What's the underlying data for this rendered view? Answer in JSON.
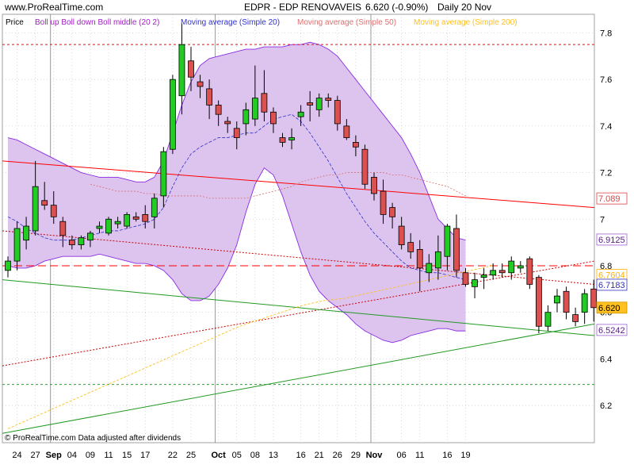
{
  "header": {
    "site": "www.ProRealTime.com",
    "title": "EDPR - EDP RENOVAVEIS",
    "quote": "6.620 (-0.90%)",
    "period": "Daily  20 Nov"
  },
  "footer": {
    "note": "© ProRealTime.com  Data adjusted after dividends"
  },
  "colors": {
    "band_fill": "#dcc4ef",
    "band_line": "#8a2be2",
    "ma20": "#3232c8",
    "ma50": "#dd7070",
    "ma200": "#ffc020",
    "up": "#22cc22",
    "down": "#dd5050",
    "grid": "#c0c0c0",
    "red_trend": "#ff0000",
    "green_trend": "#229922"
  },
  "chart_data": {
    "type": "candlestick",
    "panel_label": "Price",
    "legend": [
      {
        "name": "Boll up Boll down Boll middle (20 2)",
        "color": "#a020c0"
      },
      {
        "name": "Moving average (Simple 20)",
        "color": "#3232c8"
      },
      {
        "name": "Moving average (Simple 50)",
        "color": "#dd7070"
      },
      {
        "name": "Moving average (Simple 200)",
        "color": "#ffc020"
      }
    ],
    "ylim": [
      6.04,
      7.88
    ],
    "y_ticks": [
      6.2,
      6.4,
      6.6,
      6.8,
      7,
      7.2,
      7.4,
      7.6,
      7.8
    ],
    "y_tick_labels": [
      "6.2",
      "6.4",
      "6.6",
      "6.8",
      "7",
      "7.2",
      "7.4",
      "7.6",
      "7.8"
    ],
    "x_ticks": [
      {
        "i": 1,
        "label": "24",
        "bold": false
      },
      {
        "i": 3,
        "label": "27",
        "bold": false
      },
      {
        "i": 5,
        "label": "Sep",
        "bold": true
      },
      {
        "i": 7,
        "label": "04",
        "bold": false
      },
      {
        "i": 9,
        "label": "09",
        "bold": false
      },
      {
        "i": 11,
        "label": "11",
        "bold": false
      },
      {
        "i": 13,
        "label": "15",
        "bold": false
      },
      {
        "i": 15,
        "label": "17",
        "bold": false
      },
      {
        "i": 18,
        "label": "22",
        "bold": false
      },
      {
        "i": 20,
        "label": "25",
        "bold": false
      },
      {
        "i": 23,
        "label": "Oct",
        "bold": true
      },
      {
        "i": 25,
        "label": "05",
        "bold": false
      },
      {
        "i": 27,
        "label": "08",
        "bold": false
      },
      {
        "i": 29,
        "label": "13",
        "bold": false
      },
      {
        "i": 32,
        "label": "16",
        "bold": false
      },
      {
        "i": 34,
        "label": "21",
        "bold": false
      },
      {
        "i": 36,
        "label": "26",
        "bold": false
      },
      {
        "i": 38,
        "label": "29",
        "bold": false
      },
      {
        "i": 40,
        "label": "Nov",
        "bold": true
      },
      {
        "i": 43,
        "label": "06",
        "bold": false
      },
      {
        "i": 45,
        "label": "11",
        "bold": false
      },
      {
        "i": 48,
        "label": "16",
        "bold": false
      },
      {
        "i": 50,
        "label": "19",
        "bold": false
      }
    ],
    "month_separators": [
      5,
      23,
      40
    ],
    "candles": [
      {
        "o": 6.78,
        "h": 6.84,
        "l": 6.75,
        "c": 6.82
      },
      {
        "o": 6.82,
        "h": 6.99,
        "l": 6.78,
        "c": 6.96
      },
      {
        "o": 6.91,
        "h": 7.01,
        "l": 6.87,
        "c": 6.97
      },
      {
        "o": 6.95,
        "h": 7.25,
        "l": 6.93,
        "c": 7.14
      },
      {
        "o": 7.08,
        "h": 7.16,
        "l": 7.04,
        "c": 7.06
      },
      {
        "o": 7.06,
        "h": 7.12,
        "l": 6.98,
        "c": 7.01
      },
      {
        "o": 6.99,
        "h": 7.01,
        "l": 6.88,
        "c": 6.93
      },
      {
        "o": 6.91,
        "h": 6.93,
        "l": 6.87,
        "c": 6.89
      },
      {
        "o": 6.89,
        "h": 6.93,
        "l": 6.87,
        "c": 6.92
      },
      {
        "o": 6.91,
        "h": 6.95,
        "l": 6.88,
        "c": 6.94
      },
      {
        "o": 6.96,
        "h": 6.99,
        "l": 6.94,
        "c": 6.97
      },
      {
        "o": 6.94,
        "h": 7.01,
        "l": 6.93,
        "c": 7.0
      },
      {
        "o": 6.98,
        "h": 7.01,
        "l": 6.96,
        "c": 6.99
      },
      {
        "o": 6.97,
        "h": 7.03,
        "l": 6.96,
        "c": 7.02
      },
      {
        "o": 7.01,
        "h": 7.03,
        "l": 6.99,
        "c": 7.0
      },
      {
        "o": 7.02,
        "h": 7.06,
        "l": 6.96,
        "c": 6.99
      },
      {
        "o": 7.01,
        "h": 7.11,
        "l": 6.96,
        "c": 7.09
      },
      {
        "o": 7.1,
        "h": 7.31,
        "l": 7.05,
        "c": 7.29
      },
      {
        "o": 7.3,
        "h": 7.62,
        "l": 7.28,
        "c": 7.6
      },
      {
        "o": 7.53,
        "h": 7.84,
        "l": 7.45,
        "c": 7.75
      },
      {
        "o": 7.68,
        "h": 7.74,
        "l": 7.55,
        "c": 7.61
      },
      {
        "o": 7.59,
        "h": 7.62,
        "l": 7.52,
        "c": 7.57
      },
      {
        "o": 7.56,
        "h": 7.6,
        "l": 7.43,
        "c": 7.49
      },
      {
        "o": 7.49,
        "h": 7.51,
        "l": 7.4,
        "c": 7.45
      },
      {
        "o": 7.42,
        "h": 7.44,
        "l": 7.37,
        "c": 7.41
      },
      {
        "o": 7.39,
        "h": 7.42,
        "l": 7.3,
        "c": 7.35
      },
      {
        "o": 7.41,
        "h": 7.5,
        "l": 7.36,
        "c": 7.47
      },
      {
        "o": 7.43,
        "h": 7.66,
        "l": 7.4,
        "c": 7.52
      },
      {
        "o": 7.54,
        "h": 7.64,
        "l": 7.42,
        "c": 7.46
      },
      {
        "o": 7.46,
        "h": 7.48,
        "l": 7.37,
        "c": 7.41
      },
      {
        "o": 7.35,
        "h": 7.37,
        "l": 7.31,
        "c": 7.33
      },
      {
        "o": 7.34,
        "h": 7.39,
        "l": 7.3,
        "c": 7.35
      },
      {
        "o": 7.44,
        "h": 7.49,
        "l": 7.4,
        "c": 7.46
      },
      {
        "o": 7.5,
        "h": 7.55,
        "l": 7.42,
        "c": 7.49
      },
      {
        "o": 7.47,
        "h": 7.54,
        "l": 7.44,
        "c": 7.52
      },
      {
        "o": 7.52,
        "h": 7.54,
        "l": 7.48,
        "c": 7.51
      },
      {
        "o": 7.51,
        "h": 7.53,
        "l": 7.38,
        "c": 7.41
      },
      {
        "o": 7.4,
        "h": 7.43,
        "l": 7.34,
        "c": 7.35
      },
      {
        "o": 7.33,
        "h": 7.36,
        "l": 7.27,
        "c": 7.31
      },
      {
        "o": 7.3,
        "h": 7.32,
        "l": 7.13,
        "c": 7.15
      },
      {
        "o": 7.18,
        "h": 7.2,
        "l": 7.08,
        "c": 7.11
      },
      {
        "o": 7.12,
        "h": 7.17,
        "l": 6.98,
        "c": 7.02
      },
      {
        "o": 7.05,
        "h": 7.07,
        "l": 6.96,
        "c": 7.01
      },
      {
        "o": 6.97,
        "h": 7.01,
        "l": 6.87,
        "c": 6.89
      },
      {
        "o": 6.9,
        "h": 6.94,
        "l": 6.83,
        "c": 6.86
      },
      {
        "o": 6.87,
        "h": 6.91,
        "l": 6.69,
        "c": 6.79
      },
      {
        "o": 6.77,
        "h": 6.85,
        "l": 6.73,
        "c": 6.81
      },
      {
        "o": 6.79,
        "h": 6.93,
        "l": 6.74,
        "c": 6.86
      },
      {
        "o": 6.84,
        "h": 6.98,
        "l": 6.78,
        "c": 6.97
      },
      {
        "o": 6.96,
        "h": 7.02,
        "l": 6.75,
        "c": 6.78
      },
      {
        "o": 6.77,
        "h": 6.79,
        "l": 6.71,
        "c": 6.72
      },
      {
        "o": 6.71,
        "h": 6.77,
        "l": 6.66,
        "c": 6.74
      },
      {
        "o": 6.75,
        "h": 6.79,
        "l": 6.7,
        "c": 6.76
      },
      {
        "o": 6.76,
        "h": 6.81,
        "l": 6.74,
        "c": 6.78
      },
      {
        "o": 6.78,
        "h": 6.81,
        "l": 6.75,
        "c": 6.77
      },
      {
        "o": 6.77,
        "h": 6.84,
        "l": 6.74,
        "c": 6.82
      },
      {
        "o": 6.79,
        "h": 6.82,
        "l": 6.77,
        "c": 6.8
      },
      {
        "o": 6.83,
        "h": 6.84,
        "l": 6.7,
        "c": 6.72
      },
      {
        "o": 6.75,
        "h": 6.76,
        "l": 6.51,
        "c": 6.54
      },
      {
        "o": 6.54,
        "h": 6.63,
        "l": 6.52,
        "c": 6.6
      },
      {
        "o": 6.64,
        "h": 6.7,
        "l": 6.6,
        "c": 6.67
      },
      {
        "o": 6.69,
        "h": 6.71,
        "l": 6.57,
        "c": 6.6
      },
      {
        "o": 6.59,
        "h": 6.62,
        "l": 6.54,
        "c": 6.56
      },
      {
        "o": 6.6,
        "h": 6.7,
        "l": 6.55,
        "c": 6.68
      },
      {
        "o": 6.7,
        "h": 6.74,
        "l": 6.56,
        "c": 6.62
      }
    ],
    "boll_up": [
      7.35,
      7.34,
      7.32,
      7.3,
      7.28,
      7.26,
      7.24,
      7.22,
      7.2,
      7.19,
      7.18,
      7.18,
      7.18,
      7.17,
      7.16,
      7.16,
      7.18,
      7.25,
      7.37,
      7.49,
      7.59,
      7.66,
      7.69,
      7.7,
      7.71,
      7.72,
      7.73,
      7.73,
      7.74,
      7.74,
      7.74,
      7.75,
      7.75,
      7.76,
      7.75,
      7.73,
      7.7,
      7.65,
      7.6,
      7.55,
      7.5,
      7.45,
      7.4,
      7.35,
      7.28,
      7.2,
      7.1,
      7.0,
      6.96,
      6.92,
      6.91
    ],
    "boll_low": [
      6.8,
      6.79,
      6.79,
      6.8,
      6.82,
      6.83,
      6.84,
      6.84,
      6.84,
      6.84,
      6.85,
      6.84,
      6.83,
      6.82,
      6.81,
      6.81,
      6.8,
      6.78,
      6.74,
      6.68,
      6.65,
      6.65,
      6.67,
      6.72,
      6.79,
      6.89,
      7.03,
      7.15,
      7.22,
      7.19,
      7.1,
      6.98,
      6.86,
      6.76,
      6.69,
      6.65,
      6.62,
      6.59,
      6.55,
      6.52,
      6.5,
      6.48,
      6.47,
      6.48,
      6.5,
      6.51,
      6.52,
      6.53,
      6.53,
      6.52,
      6.52
    ],
    "ma20": [
      7.01,
      6.99,
      6.96,
      6.94,
      6.92,
      6.91,
      6.91,
      6.91,
      6.92,
      6.93,
      6.94,
      6.95,
      6.95,
      6.96,
      6.97,
      6.98,
      7.0,
      7.05,
      7.14,
      7.22,
      7.28,
      7.31,
      7.33,
      7.35,
      7.35,
      7.36,
      7.37,
      7.37,
      7.4,
      7.43,
      7.44,
      7.45,
      7.42,
      7.37,
      7.31,
      7.25,
      7.18,
      7.11,
      7.05,
      6.99,
      6.94,
      6.9,
      6.86,
      6.82,
      6.79,
      6.78,
      6.77,
      6.77,
      6.76,
      6.75,
      6.74
    ],
    "ma50": [
      7.15,
      7.14,
      7.13,
      7.12,
      7.12,
      7.12,
      7.11,
      7.11,
      7.1,
      7.1,
      7.1,
      7.1,
      7.1,
      7.09,
      7.09,
      7.09,
      7.09,
      7.09,
      7.1,
      7.11,
      7.12,
      7.13,
      7.14,
      7.16,
      7.17,
      7.18,
      7.19,
      7.19,
      7.2,
      7.2,
      7.2,
      7.2,
      7.2,
      7.19,
      7.19,
      7.18,
      7.17,
      7.16,
      7.15,
      7.14,
      7.12,
      7.1
    ],
    "ma200": [
      6.1,
      6.14,
      6.18,
      6.22,
      6.26,
      6.3,
      6.34,
      6.38,
      6.42,
      6.46,
      6.5,
      6.54,
      6.57,
      6.6,
      6.63,
      6.65,
      6.66,
      6.68,
      6.7,
      6.72,
      6.74,
      6.76,
      6.78,
      6.8
    ],
    "ma50_start": 9,
    "ma200_start": 0,
    "ma200_step": 2.3,
    "ref_lines": [
      {
        "name": "red-dashed-top",
        "y": 7.75,
        "color": "#ff0000",
        "dash": "3,3"
      },
      {
        "name": "red-long-dash",
        "y": 6.8,
        "color": "#ff0000",
        "dash": "10,5"
      },
      {
        "name": "green-dashed",
        "y": 6.29,
        "color": "#22aa22",
        "dash": "3,3"
      }
    ],
    "trend_lines": [
      {
        "name": "red-trend-solid",
        "from": {
          "i": 0,
          "v": 7.25
        },
        "to": {
          "i": 53,
          "v": 7.05
        },
        "color": "#ff0000",
        "dash": ""
      },
      {
        "name": "red-trend-dotted-down",
        "from": {
          "i": 0,
          "v": 6.95
        },
        "to": {
          "i": 53,
          "v": 6.72
        },
        "color": "#cc0000",
        "dash": "2,2"
      },
      {
        "name": "red-trend-dotted-up",
        "from": {
          "i": 0,
          "v": 6.37
        },
        "to": {
          "i": 53,
          "v": 6.82
        },
        "color": "#cc0000",
        "dash": "2,2"
      },
      {
        "name": "green-trend-down",
        "from": {
          "i": 0,
          "v": 6.74
        },
        "to": {
          "i": 53,
          "v": 6.5
        },
        "color": "#229922",
        "dash": ""
      },
      {
        "name": "green-trend-up",
        "from": {
          "i": 0,
          "v": 6.08
        },
        "to": {
          "i": 53,
          "v": 6.55
        },
        "color": "#229922",
        "dash": ""
      }
    ],
    "value_tags": [
      {
        "label": "7.089",
        "v": 7.089,
        "text_color": "#dd4444",
        "bg": "#ffffff",
        "border": "#dd4444"
      },
      {
        "label": "6.9125",
        "v": 6.9125,
        "text_color": "#5a1a90",
        "bg": "#ffffff",
        "border": "#a060d0"
      },
      {
        "label": "6.7604",
        "v": 6.7604,
        "text_color": "#ffb000",
        "bg": "#ffffff",
        "border": "#ffb000"
      },
      {
        "label": "6.7183",
        "v": 6.7183,
        "text_color": "#3030c0",
        "bg": "#ffffff",
        "border": "#3030c0"
      },
      {
        "label": "6.620",
        "v": 6.62,
        "text_color": "#000000",
        "bg": "#ffc020",
        "border": "#cc9900"
      },
      {
        "label": "6.5242",
        "v": 6.5242,
        "text_color": "#5a1a90",
        "bg": "#ffffff",
        "border": "#a060d0"
      }
    ]
  }
}
